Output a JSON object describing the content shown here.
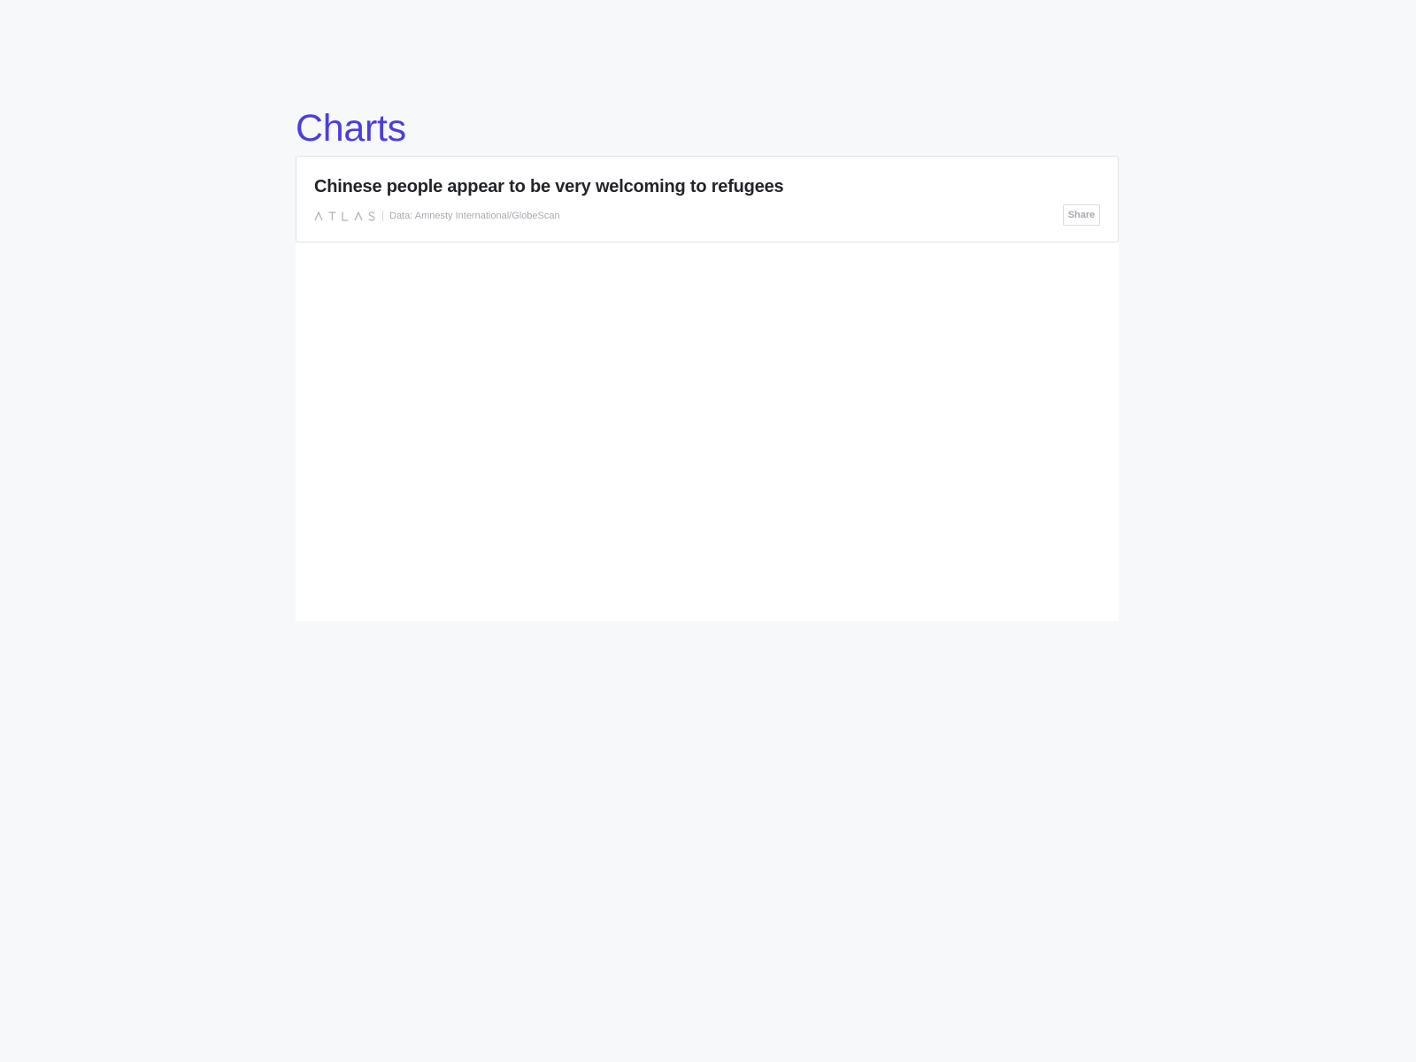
{
  "page": {
    "heading": "Charts"
  },
  "chart_card": {
    "title": "Chinese people appear to be very welcoming to refugees",
    "brand": {
      "name": "ATLAS",
      "icon": "atlas-logo"
    },
    "source": "Data: Amnesty International/GlobeScan",
    "share_label": "Share"
  },
  "colors": {
    "heading": "#4a3fd9",
    "title": "#222428",
    "muted": "#a7aab0",
    "background": "#f7f8fa",
    "card": "#ffffff"
  }
}
